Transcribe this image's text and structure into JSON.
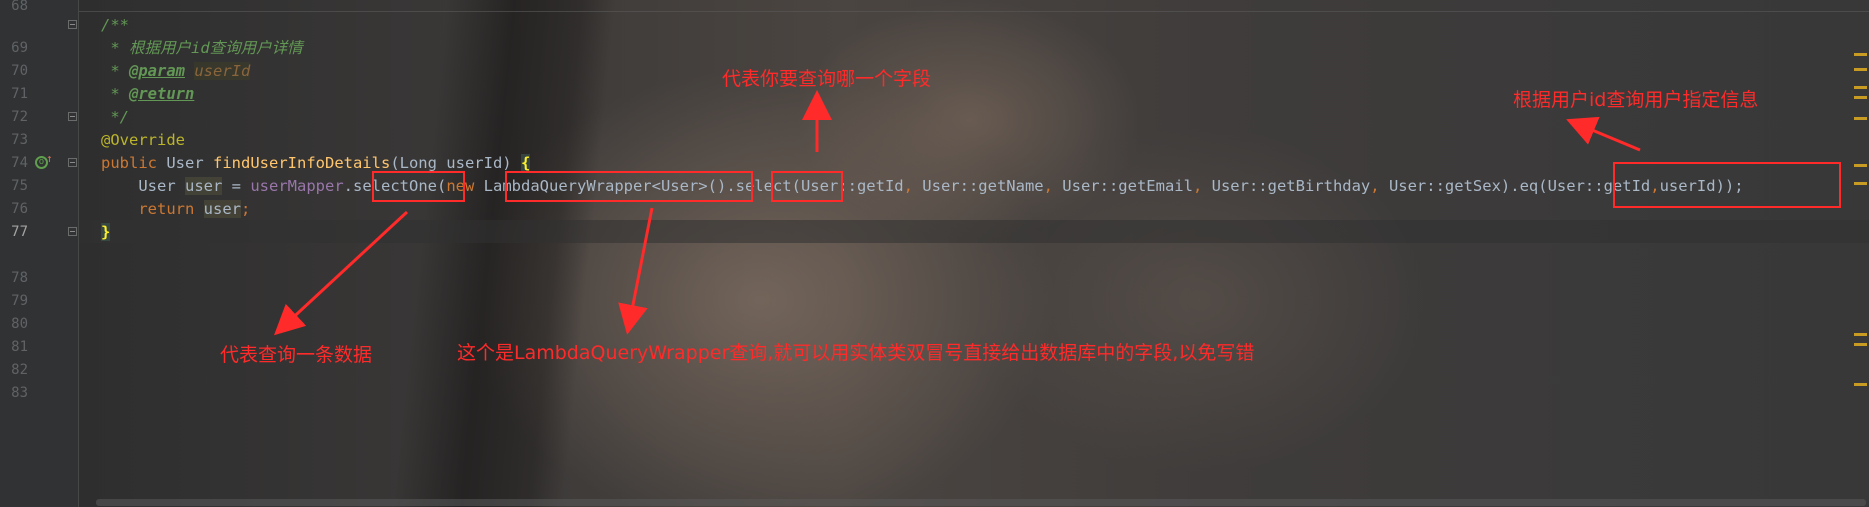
{
  "editor": {
    "line_numbers": [
      "68",
      "69",
      "70",
      "71",
      "72",
      "73",
      "74",
      "75",
      "76",
      "77",
      "78",
      "79",
      "80",
      "81",
      "82",
      "83"
    ],
    "current_line": "77",
    "code": {
      "l68": "/**",
      "l69": " * 根据用户id查询用户详情",
      "l70_star": " * ",
      "l70_tag": "@param",
      "l70_name": "userId",
      "l71_star": " * ",
      "l71_tag": "@return",
      "l72": " */",
      "l73": "@Override",
      "l74_kw": "public ",
      "l74_type": "User ",
      "l74_fn": "findUserInfoDetails",
      "l74_params": "(Long userId) ",
      "l74_brace": "{",
      "l75_indent": "    ",
      "l75_type": "User ",
      "l75_var": "user",
      "l75_eq": " = ",
      "l75_field": "userMapper",
      "l75_dot1": ".",
      "l75_select_one": "selectOne",
      "l75_paren1": "(",
      "l75_new": "new ",
      "l75_wrapper": "LambdaQueryWrapper<User>",
      "l75_paren2": "()",
      "l75_select": ".select",
      "l75_args_a": "(User::getId",
      "l75_comma1": ", ",
      "l75_args_b": "User::getName",
      "l75_comma2": ", ",
      "l75_args_c": "User::getEmail",
      "l75_comma3": ", ",
      "l75_args_d": "User::getBirthday",
      "l75_comma4": ", ",
      "l75_args_e": "User::getSex)",
      "l75_eq_call": ".eq(User::getId",
      "l75_comma5": ",",
      "l75_eq_end": "userId));",
      "l76_indent": "    ",
      "l76_kw": "return ",
      "l76_var": "user",
      "l76_semi": ";",
      "l77": "}"
    }
  },
  "annotations": {
    "select_field": "代表你要查询哪一个字段",
    "eq_condition": "根据用户id查询用户指定信息",
    "select_one": "代表查询一条数据",
    "lambda_wrapper": "这个是LambdaQueryWrapper查询,就可以用实体类双冒号直接给出数据库中的字段,以免写错"
  },
  "colors": {
    "annotation_red": "#ff2a2a",
    "keyword": "#cc7832",
    "comment": "#629755",
    "annotation_yellow": "#bbb529",
    "method": "#ffc66d",
    "field": "#9876aa"
  },
  "icons": [
    "override-gutter-icon",
    "fold-icon"
  ]
}
